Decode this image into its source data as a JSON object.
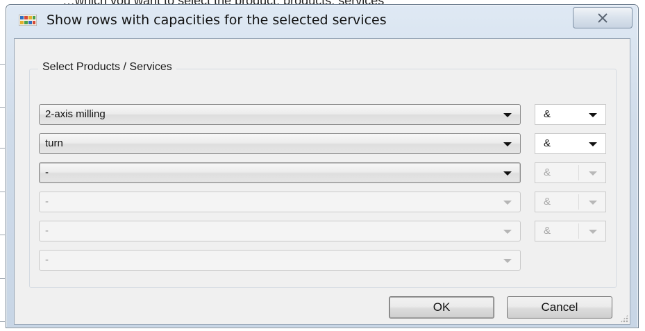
{
  "background": {
    "peek_text": "…which you want to select the product, products, services"
  },
  "dialog": {
    "title": "Show rows with capacities for the selected services",
    "icon": "app-grid-icon",
    "close_glyph": "✕"
  },
  "group": {
    "label": "Select Products / Services",
    "rows": [
      {
        "value": "2-axis milling",
        "enabled": true,
        "operator": "&",
        "operator_enabled": true
      },
      {
        "value": "turn",
        "enabled": true,
        "operator": "&",
        "operator_enabled": true
      },
      {
        "value": "-",
        "enabled": true,
        "operator": "&",
        "operator_enabled": false
      },
      {
        "value": "-",
        "enabled": false,
        "operator": "&",
        "operator_enabled": false
      },
      {
        "value": "-",
        "enabled": false,
        "operator": "&",
        "operator_enabled": false
      },
      {
        "value": "-",
        "enabled": false
      }
    ]
  },
  "buttons": {
    "ok": "OK",
    "cancel": "Cancel"
  },
  "colors": {
    "titlebar": "#cfdbe9",
    "client": "#f0f0f0",
    "border": "#6f7f90"
  }
}
